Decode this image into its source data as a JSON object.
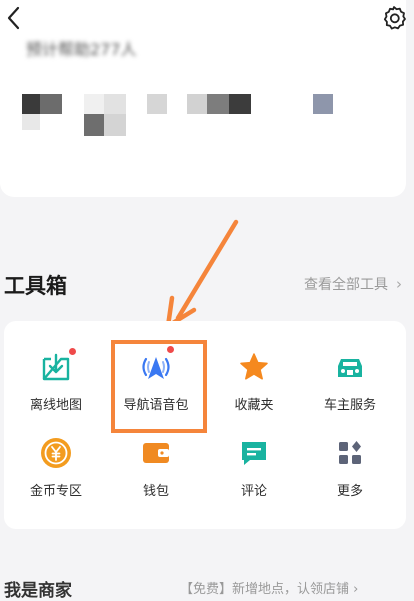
{
  "header": {
    "back_icon": "back-chevron-icon",
    "settings_icon": "gear-icon"
  },
  "profile_card": {
    "blurred_line": "预计帮助277人"
  },
  "toolbox": {
    "title": "工具箱",
    "see_all": "查看全部工具",
    "see_all_chevron": "›",
    "items": [
      {
        "label": "离线地图",
        "icon": "offline-map-download-icon",
        "badge": true,
        "color": "#19b3a0"
      },
      {
        "label": "导航语音包",
        "icon": "voice-pack-icon",
        "badge": true,
        "color": "#3a78f2"
      },
      {
        "label": "收藏夹",
        "icon": "star-icon",
        "badge": false,
        "color": "#f5891f"
      },
      {
        "label": "车主服务",
        "icon": "car-icon",
        "badge": false,
        "color": "#19b3a0"
      },
      {
        "label": "金币专区",
        "icon": "gold-coin-icon",
        "badge": false,
        "color": "#f39c1f"
      },
      {
        "label": "钱包",
        "icon": "wallet-icon",
        "badge": false,
        "color": "#f08a22"
      },
      {
        "label": "评论",
        "icon": "comment-icon",
        "badge": false,
        "color": "#19b3a0"
      },
      {
        "label": "更多",
        "icon": "more-grid-icon",
        "badge": false,
        "color": "#5d6478"
      }
    ]
  },
  "annotation": {
    "highlight_color": "#f5853b"
  },
  "bottom": {
    "left": "我是商家",
    "right": "【免费】新增地点，认领店铺 ›"
  }
}
